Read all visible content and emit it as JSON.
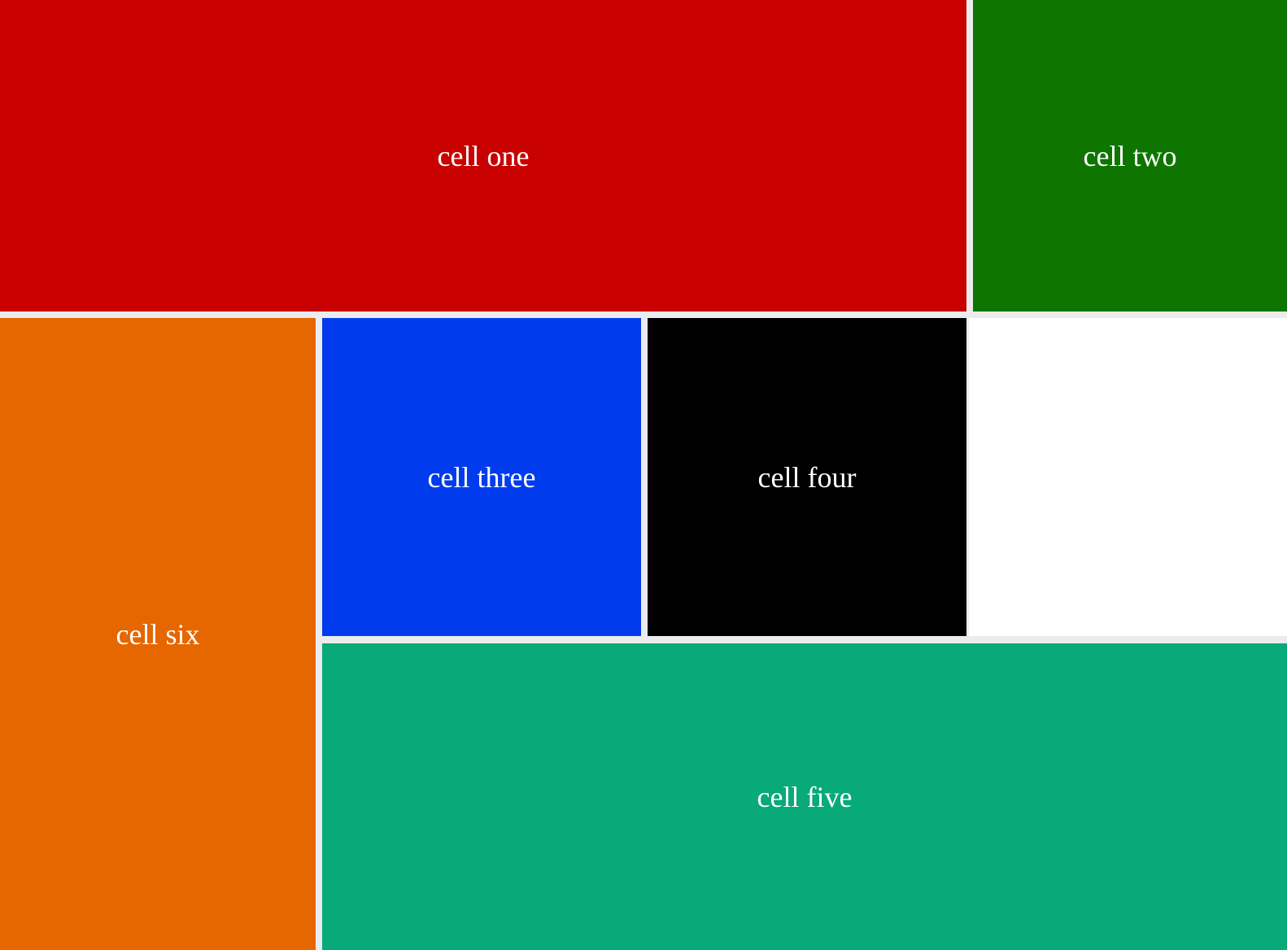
{
  "cells": {
    "one": {
      "label": "cell one",
      "color": "#c80000"
    },
    "two": {
      "label": "cell two",
      "color": "#0e7600"
    },
    "three": {
      "label": "cell three",
      "color": "#003cee"
    },
    "four": {
      "label": "cell four",
      "color": "#000000"
    },
    "five": {
      "label": "cell five",
      "color": "#07aa78"
    },
    "six": {
      "label": "cell six",
      "color": "#e66600"
    }
  },
  "colors": {
    "background": "#ffffff",
    "gutter": "#ececec",
    "text": "#ffffff"
  }
}
